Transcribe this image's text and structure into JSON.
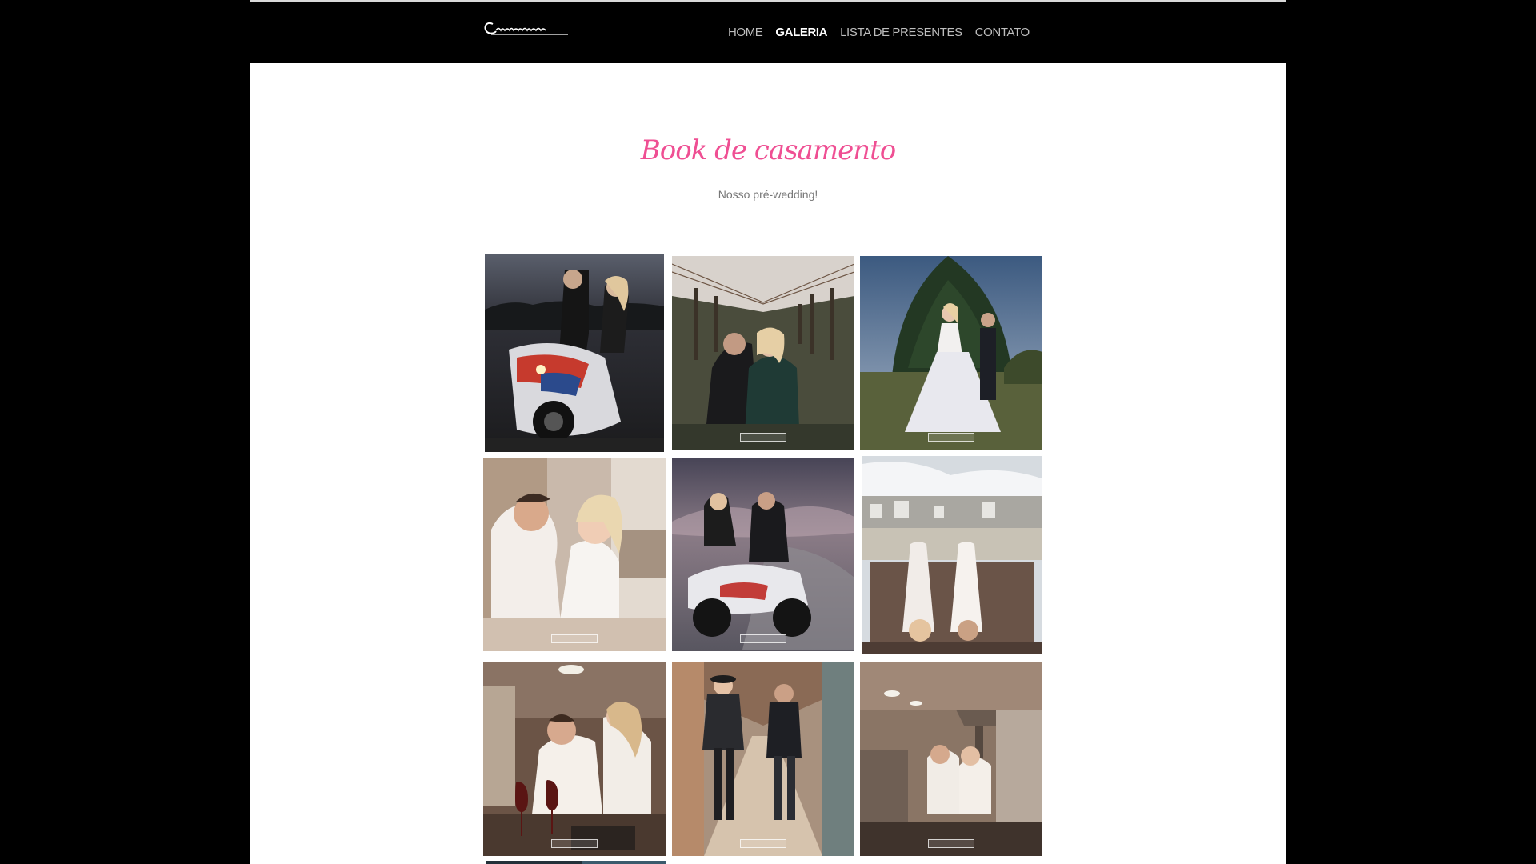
{
  "header": {
    "logo_text": "Casamento",
    "nav": [
      {
        "label": "HOME",
        "active": false
      },
      {
        "label": "GALERIA",
        "active": true
      },
      {
        "label": "LISTA DE PRESENTES",
        "active": false
      },
      {
        "label": "CONTATO",
        "active": false
      }
    ]
  },
  "gallery": {
    "title": "Book de casamento",
    "subtitle": "Nosso pré-wedding!"
  },
  "colors": {
    "accent": "#ef4f93",
    "header_bg": "#000000"
  }
}
